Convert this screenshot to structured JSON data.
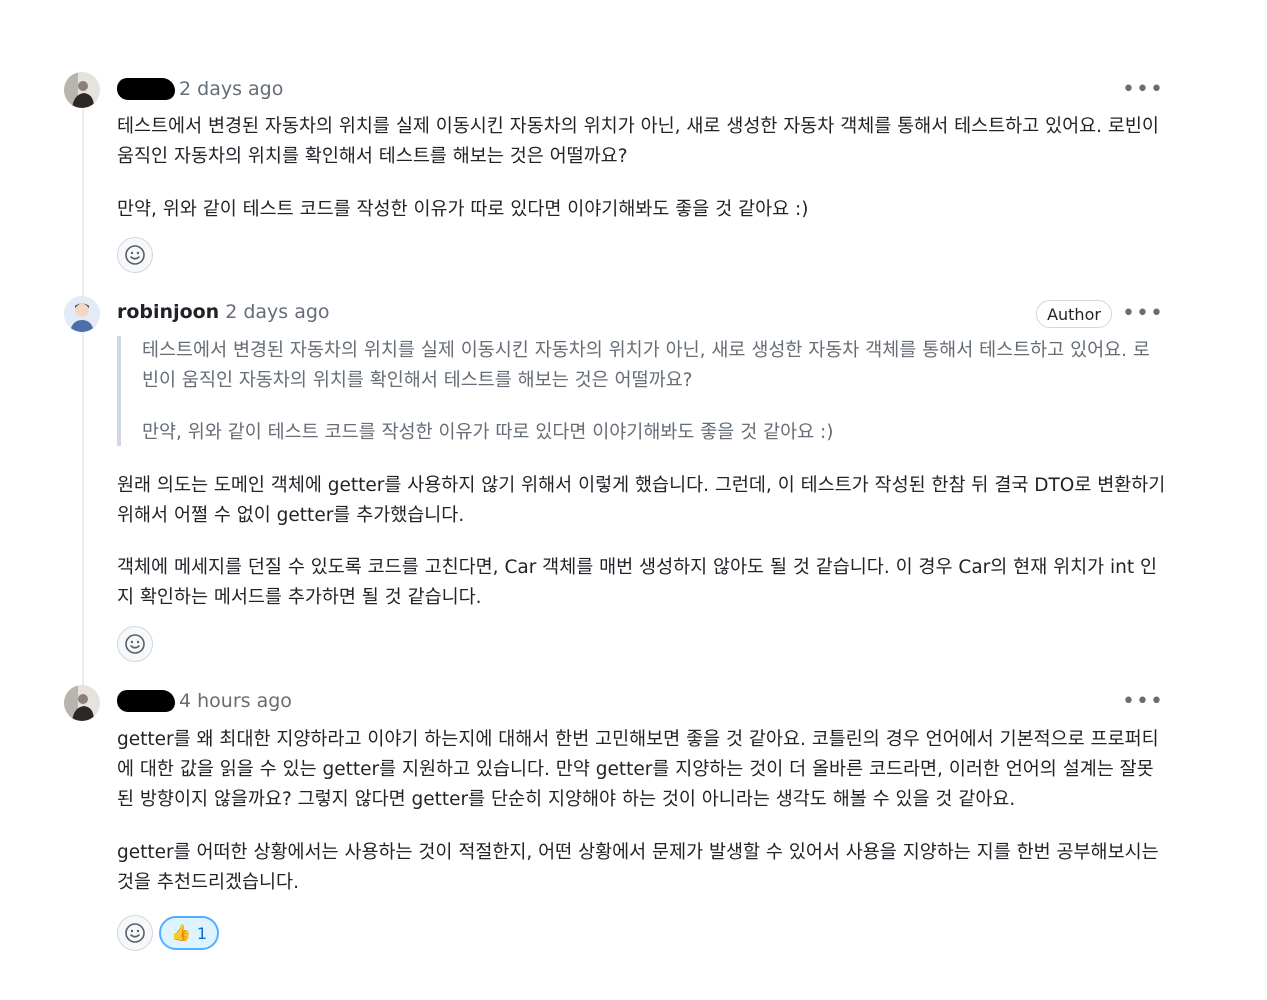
{
  "comments": [
    {
      "author": "",
      "time": "2 days ago",
      "more_label": "•••",
      "paragraphs": [
        "테스트에서 변경된 자동차의 위치를 실제 이동시킨 자동차의 위치가 아닌, 새로 생성한 자동차 객체를 통해서 테스트하고 있어요. 로빈이 움직인 자동차의 위치를 확인해서 테스트를 해보는 것은 어떨까요?",
        "만약, 위와 같이 테스트 코드를 작성한 이유가 따로 있다면 이야기해봐도 좋을 것 같아요 :)"
      ]
    },
    {
      "author": "robinjoon",
      "time": "2 days ago",
      "badge": "Author",
      "more_label": "•••",
      "quote": [
        "테스트에서 변경된 자동차의 위치를 실제 이동시킨 자동차의 위치가 아닌, 새로 생성한 자동차 객체를 통해서 테스트하고 있어요. 로빈이 움직인 자동차의 위치를 확인해서 테스트를 해보는 것은 어떨까요?",
        "만약, 위와 같이 테스트 코드를 작성한 이유가 따로 있다면 이야기해봐도 좋을 것 같아요 :)"
      ],
      "paragraphs": [
        "원래 의도는 도메인 객체에 getter를 사용하지 않기 위해서 이렇게 했습니다. 그런데, 이 테스트가 작성된 한참 뒤 결국 DTO로 변환하기 위해서 어쩔 수 없이 getter를 추가했습니다.",
        "객체에 메세지를 던질 수 있도록 코드를 고친다면, Car 객체를 매번 생성하지 않아도 될 것 같습니다. 이 경우 Car의 현재 위치가 int 인지 확인하는 메서드를 추가하면 될 것 같습니다."
      ]
    },
    {
      "author": "",
      "time": "4 hours ago",
      "more_label": "•••",
      "paragraphs": [
        "getter를 왜 최대한 지양하라고 이야기 하는지에 대해서 한번 고민해보면 좋을 것 같아요. 코틀린의 경우 언어에서 기본적으로 프로퍼티에 대한 값을 읽을 수 있는 getter를 지원하고 있습니다. 만약 getter를 지양하는 것이 더 올바른 코드라면, 이러한 언어의 설계는 잘못된 방향이지 않을까요? 그렇지 않다면 getter를 단순히 지양해야 하는 것이 아니라는 생각도 해볼 수 있을 것 같아요.",
        "getter를 어떠한 상황에서는 사용하는 것이 적절한지, 어떤 상황에서 문제가 발생할 수 있어서 사용을 지양하는 지를 한번 공부해보시는 것을 추천드리겠습니다."
      ],
      "reaction": {
        "emoji": "👍",
        "count": "1"
      }
    }
  ],
  "icons": {
    "add_reaction": "smiley-icon",
    "more": "kebab-horizontal-icon"
  },
  "colors": {
    "accent": "#0969da",
    "reaction_border": "#54aeff",
    "reaction_bg": "#ddf4ff",
    "muted": "#656d76"
  }
}
